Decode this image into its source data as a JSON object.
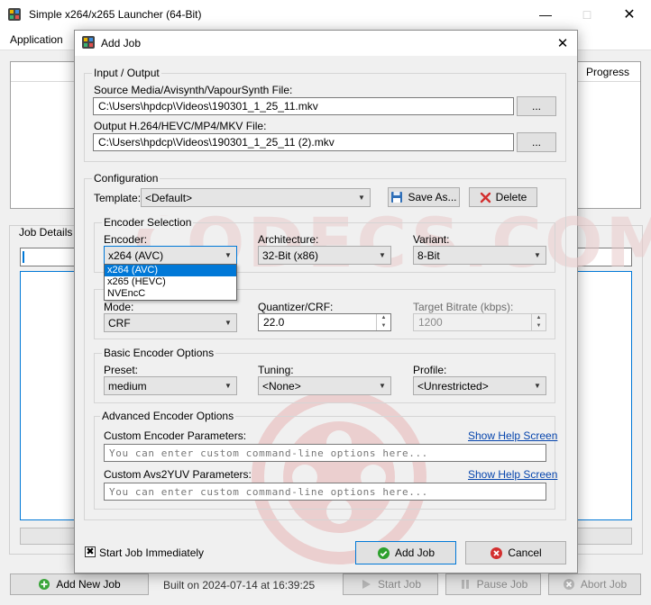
{
  "main_window": {
    "title": "Simple x264/x265 Launcher (64-Bit)",
    "menu": [
      "Application"
    ],
    "joblist_header_progress": "Progress",
    "job_details_label": "Job Details",
    "buttons": {
      "add_new_job": "Add New Job",
      "start_job": "Start Job",
      "pause_job": "Pause Job",
      "abort_job": "Abort Job"
    },
    "built_on": "Built on 2024-07-14 at 16:39:25"
  },
  "watermark": "CODECS.COM",
  "dialog": {
    "title": "Add Job",
    "input_output": {
      "group_label": "Input / Output",
      "source_label": "Source Media/Avisynth/VapourSynth File:",
      "source_value": "C:\\Users\\hpdcp\\Videos\\190301_1_25_11.mkv",
      "output_label": "Output H.264/HEVC/MP4/MKV File:",
      "output_value": "C:\\Users\\hpdcp\\Videos\\190301_1_25_11 (2).mkv",
      "browse_label": "..."
    },
    "configuration": {
      "group_label": "Configuration",
      "template_label": "Template:",
      "template_value": "<Default>",
      "save_as_label": "Save As...",
      "delete_label": "Delete"
    },
    "encoder_selection": {
      "group_label": "Encoder Selection",
      "encoder_label": "Encoder:",
      "encoder_value": "x264 (AVC)",
      "encoder_options": [
        "x264 (AVC)",
        "x265 (HEVC)",
        "NVEncC"
      ],
      "architecture_label": "Architecture:",
      "architecture_value": "32-Bit (x86)",
      "variant_label": "Variant:",
      "variant_value": "8-Bit"
    },
    "rate_control": {
      "mode_label": "Mode:",
      "mode_value": "CRF",
      "quantizer_label": "Quantizer/CRF:",
      "quantizer_value": "22.0",
      "bitrate_label": "Target Bitrate (kbps):",
      "bitrate_value": "1200"
    },
    "basic_options": {
      "group_label": "Basic Encoder Options",
      "preset_label": "Preset:",
      "preset_value": "medium",
      "tuning_label": "Tuning:",
      "tuning_value": "<None>",
      "profile_label": "Profile:",
      "profile_value": "<Unrestricted>"
    },
    "advanced_options": {
      "group_label": "Advanced Encoder Options",
      "custom_encoder_label": "Custom Encoder Parameters:",
      "custom_avs_label": "Custom Avs2YUV Parameters:",
      "help_link": "Show Help Screen",
      "placeholder": "You can enter custom command-line options here..."
    },
    "start_immediately_label": "Start Job Immediately",
    "add_job_label": "Add Job",
    "cancel_label": "Cancel"
  },
  "colors": {
    "accent": "#0078d7",
    "ok_green": "#2ca02c",
    "cancel_red": "#d32f2f",
    "link": "#0645ad"
  }
}
